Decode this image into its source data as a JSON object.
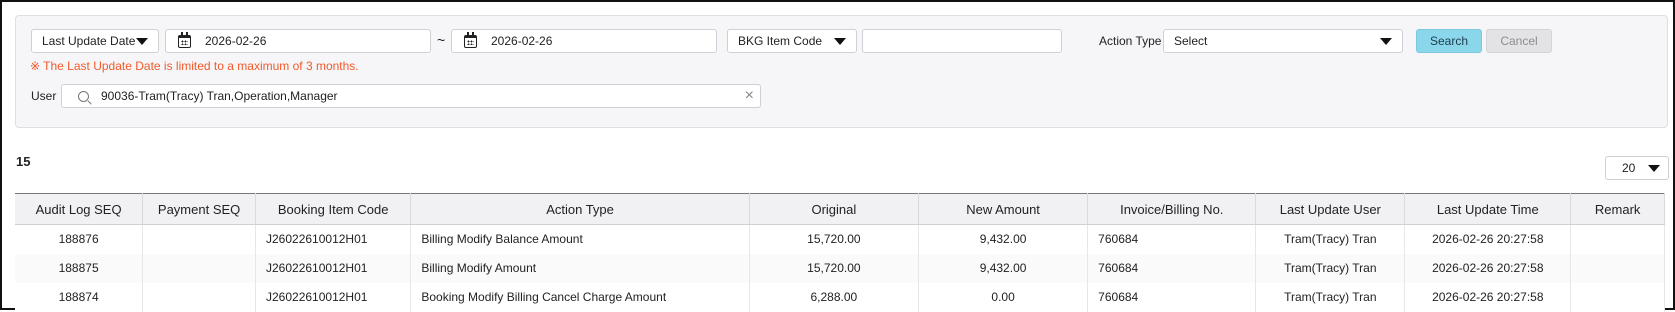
{
  "filters": {
    "date_type": "Last Update Date",
    "date_from": "2026-02-26",
    "separator": "~",
    "date_to": "2026-02-26",
    "item_code_type": "BKG Item Code",
    "item_code_value": "",
    "action_type_label": "Action Type",
    "action_type_value": "Select",
    "search_label": "Search",
    "cancel_label": "Cancel",
    "warning": "※ The Last Update Date is limited to a maximum of 3 months.",
    "user_label": "User",
    "user_value": "90036-Tram(Tracy) Tran,Operation,Manager",
    "clear_glyph": "×"
  },
  "results": {
    "count": "15",
    "page_size": "20"
  },
  "table": {
    "headers": [
      "Audit Log SEQ",
      "Payment SEQ",
      "Booking Item Code",
      "Action Type",
      "Original",
      "New Amount",
      "Invoice/Billing No.",
      "Last Update User",
      "Last Update Time",
      "Remark"
    ],
    "rows": [
      [
        "188876",
        "",
        "J26022610012H01",
        "Billing Modify Balance Amount",
        "15,720.00",
        "9,432.00",
        "760684",
        "Tram(Tracy) Tran",
        "2026-02-26 20:27:58",
        ""
      ],
      [
        "188875",
        "",
        "J26022610012H01",
        "Billing Modify Amount",
        "15,720.00",
        "9,432.00",
        "760684",
        "Tram(Tracy) Tran",
        "2026-02-26 20:27:58",
        ""
      ],
      [
        "188874",
        "",
        "J26022610012H01",
        "Booking Modify Billing Cancel Charge Amount",
        "6,288.00",
        "0.00",
        "760684",
        "Tram(Tracy) Tran",
        "2026-02-26 20:27:58",
        ""
      ]
    ]
  },
  "colors": {
    "warning": "#f15a2b",
    "search_button": "#8ad7ec",
    "cancel_button": "#e3e3e6"
  }
}
